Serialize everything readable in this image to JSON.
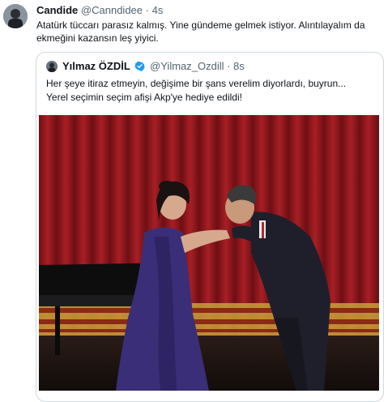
{
  "tweet": {
    "author_name": "Candide",
    "author_handle": "@Canndidee",
    "separator": "·",
    "time": "4s",
    "text": "Atatürk tüccarı parasız kalmış. Yine gündeme gelmek istiyor. Alıntılayalım da ekmeğini kazansın leş yiyici."
  },
  "quoted": {
    "author_name": "Yılmaz ÖZDİL",
    "author_handle": "@Yilmaz_Ozdill",
    "separator": "·",
    "time": "8s",
    "line1": "Her şeye itiraz etmeyin, değişime bir şans verelim diyorlardı, buyrun...",
    "line2": "Yerel seçimin seçim afişi Akp'ye hediye edildi!"
  },
  "colors": {
    "text": "#0f1419",
    "muted": "#536471",
    "verified": "#1d9bf0",
    "border": "#cfd9de",
    "curtain": "#9d1d22",
    "dress": "#3a2e78"
  },
  "icons": {
    "verified": "verified-badge-icon"
  }
}
